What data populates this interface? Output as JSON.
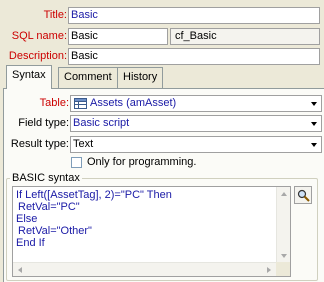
{
  "form": {
    "title_label": "Title:",
    "title_value": "Basic",
    "sqlname_label": "SQL name:",
    "sqlname_value": "Basic",
    "sqlname_full": "cf_Basic",
    "description_label": "Description:",
    "description_value": "Basic"
  },
  "tabs": [
    {
      "label": "Syntax",
      "active": true
    },
    {
      "label": "Comment",
      "active": false
    },
    {
      "label": "History",
      "active": false
    }
  ],
  "syntax": {
    "table_label": "Table:",
    "table_value": "Assets (amAsset)",
    "table_icon": "table-icon",
    "field_type_label": "Field type:",
    "field_type_value": "Basic script",
    "result_type_label": "Result type:",
    "result_type_value": "Text",
    "programming_only_label": "Only for programming.",
    "programming_only_checked": false
  },
  "basic_syntax": {
    "group_label": "BASIC syntax",
    "code_lines": [
      "If Left([AssetTag], 2)=\"PC\" Then",
      "RetVal=\"PC\"",
      "Else",
      "RetVal=\"Other\"",
      "End If"
    ],
    "tool_icon": "magnifier-icon"
  },
  "colors": {
    "label_red": "#cc0000",
    "value_blue": "#1a1aa6",
    "window_bg": "#ece9d8"
  }
}
